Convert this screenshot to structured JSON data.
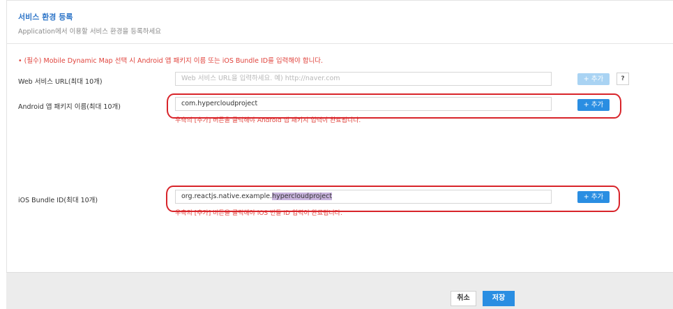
{
  "header": {
    "title": "서비스 환경 등록",
    "subtitle": "Application에서 이용할 서비스 환경을 등록하세요"
  },
  "notice": "• (필수) Mobile Dynamic Map 선택 시 Android 앱 패키지 이름 또는 iOS Bundle ID를 입력해야 합니다.",
  "web": {
    "label": "Web 서비스 URL(최대 10개)",
    "placeholder": "Web 서비스 URL을 입력하세요. 예) http://naver.com",
    "value": "",
    "add_label": "+ 추가",
    "help": "?"
  },
  "android": {
    "label": "Android 앱 패키지 이름(최대 10개)",
    "value": "com.hypercloudproject",
    "add_label": "+ 추가",
    "hint": "우측의 [추가] 버튼을 클릭해야 Android 앱 패키지 입력이 완료됩니다."
  },
  "ios": {
    "label": "iOS Bundle ID(최대 10개)",
    "value_prefix": "org.reactjs.native.example.",
    "value_selected": "hypercloudproject",
    "add_label": "+ 추가",
    "hint": "우측의 [추가] 버튼을 클릭해야 iOS 번들 ID 입력이 완료됩니다."
  },
  "footer": {
    "cancel_label": "취소",
    "save_label": "저장"
  },
  "colors": {
    "accent": "#2a8ee2",
    "title": "#2f76c8",
    "error": "#e0433c",
    "annotation": "#d8242a"
  }
}
